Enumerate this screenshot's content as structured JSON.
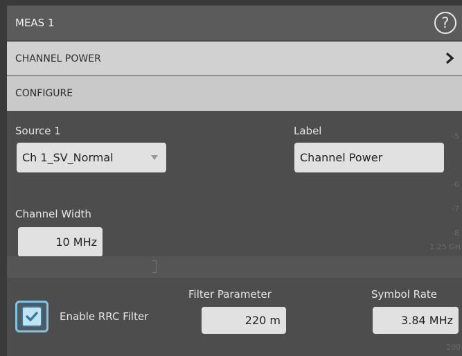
{
  "title": "MEAS 1",
  "help_icon": "?",
  "sections": {
    "channel_power": "CHANNEL POWER",
    "configure": "CONFIGURE"
  },
  "source": {
    "label": "Source 1",
    "value": "Ch 1_SV_Normal"
  },
  "label_field": {
    "label": "Label",
    "value": "Channel Power"
  },
  "channel_width": {
    "label": "Channel Width",
    "value": "10 MHz"
  },
  "rrc": {
    "checkbox_label": "Enable RRC Filter",
    "checked": true
  },
  "filter_parameter": {
    "label": "Filter Parameter",
    "value": "220 m"
  },
  "symbol_rate": {
    "label": "Symbol Rate",
    "value": "3.84 MHz"
  },
  "background_scale": [
    "-5",
    "-6",
    "-7",
    "-8",
    "1.25 GH",
    "200"
  ],
  "colors": {
    "accent": "#7fc4e6",
    "checkbox_fill": "#2e7ba6"
  }
}
